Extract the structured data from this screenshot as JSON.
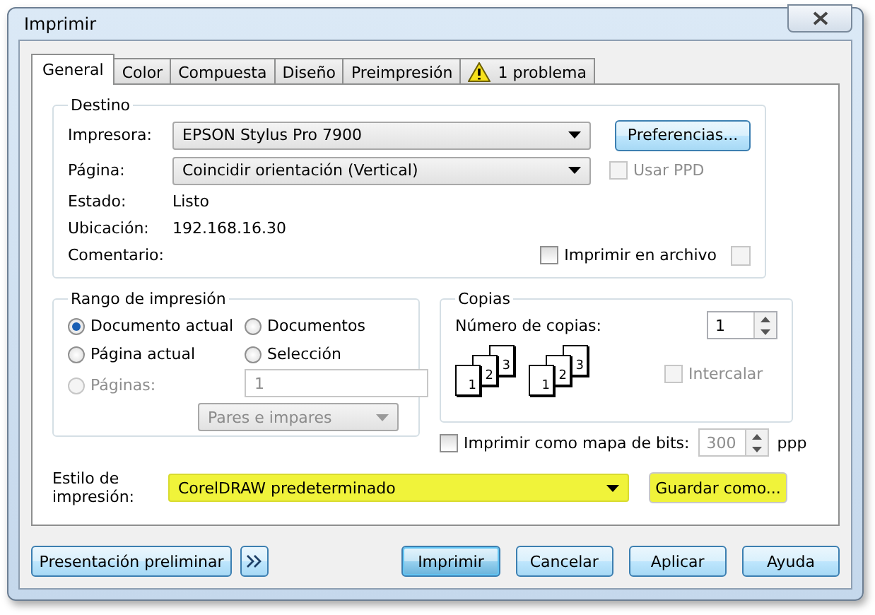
{
  "window": {
    "title": "Imprimir"
  },
  "tabs": [
    {
      "label": "General",
      "selected": true,
      "kind": "text"
    },
    {
      "label": "Color",
      "selected": false,
      "kind": "text"
    },
    {
      "label": "Compuesta",
      "selected": false,
      "kind": "text"
    },
    {
      "label": "Diseño",
      "selected": false,
      "kind": "text"
    },
    {
      "label": "Preimpresión",
      "selected": false,
      "kind": "text"
    },
    {
      "label": "1 problema",
      "selected": false,
      "kind": "warning"
    }
  ],
  "destination": {
    "title": "Destino",
    "printer": {
      "label": "Impresora:",
      "value": "EPSON Stylus Pro 7900"
    },
    "preferences_button": "Preferencias...",
    "page": {
      "label": "Página:",
      "value": "Coincidir orientación (Vertical)"
    },
    "use_ppd": {
      "label": "Usar PPD",
      "checked": false,
      "disabled": true
    },
    "status": {
      "label": "Estado:",
      "value": "Listo"
    },
    "location": {
      "label": "Ubicación:",
      "value": "192.168.16.30"
    },
    "comment": {
      "label": "Comentario:"
    },
    "print_to_file": {
      "label": "Imprimir en archivo",
      "checked": false
    }
  },
  "range": {
    "title": "Rango de impresión",
    "options": [
      {
        "label": "Documento actual",
        "selected": true,
        "disabled": false
      },
      {
        "label": "Documentos",
        "selected": false,
        "disabled": false
      },
      {
        "label": "Página actual",
        "selected": false,
        "disabled": false
      },
      {
        "label": "Selección",
        "selected": false,
        "disabled": false
      },
      {
        "label": "Páginas:",
        "selected": false,
        "disabled": true
      }
    ],
    "pages_value": "1",
    "parity": {
      "value": "Pares e impares",
      "disabled": true
    }
  },
  "copies": {
    "title": "Copias",
    "label": "Número de copias:",
    "value": "1",
    "stacks": [
      {
        "pages": [
          "1",
          "2",
          "3"
        ]
      },
      {
        "pages": [
          "1",
          "2",
          "3"
        ]
      }
    ],
    "collate": {
      "label": "Intercalar",
      "checked": false,
      "disabled": true
    }
  },
  "bitmap": {
    "label": "Imprimir como mapa de bits:",
    "checked": false,
    "dpi": "300",
    "unit": "ppp"
  },
  "print_style": {
    "label": "Estilo de impresión:",
    "value": "CorelDRAW predeterminado",
    "highlighted": true,
    "save_button": "Guardar como..."
  },
  "footer": {
    "preview_button": "Presentación preliminar",
    "buttons": [
      {
        "label": "Imprimir",
        "default": true
      },
      {
        "label": "Cancelar",
        "default": false
      },
      {
        "label": "Aplicar",
        "default": false
      },
      {
        "label": "Ayuda",
        "default": false
      }
    ]
  }
}
